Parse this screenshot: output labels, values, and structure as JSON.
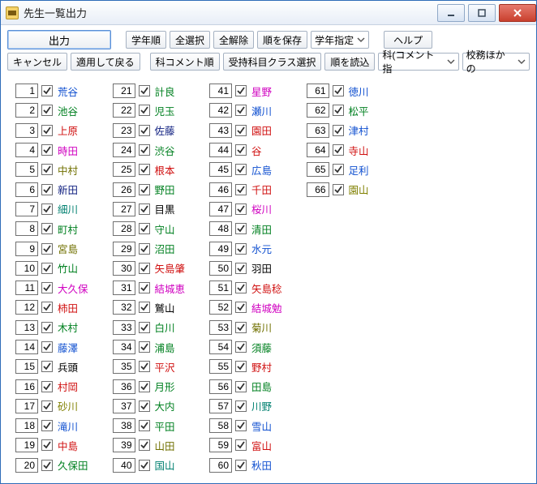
{
  "window": {
    "title": "先生一覧出力"
  },
  "toolbar": {
    "row1": {
      "primary": "出力",
      "b1": "学年順",
      "b2": "全選択",
      "b3": "全解除",
      "b4": "順を保存",
      "sel1": "学年指定",
      "help": "ヘルプ"
    },
    "row2": {
      "cancel": "キャンセル",
      "apply": "適用して戻る",
      "b1": "科コメント順",
      "b2": "受持科目クラス選択",
      "b3": "順を読込",
      "sel1": "科(コメント指",
      "sel2": "校務ほかの"
    }
  },
  "colors": {
    "blue": "#1050d0",
    "green": "#008020",
    "red": "#d01010",
    "magenta": "#d000c0",
    "darkolive": "#707000",
    "navy": "#102080",
    "teal": "#008070",
    "black": "#000000",
    "olive": "#808000"
  },
  "teachers": [
    {
      "n": 1,
      "name": "荒谷",
      "c": "blue"
    },
    {
      "n": 2,
      "name": "池谷",
      "c": "green"
    },
    {
      "n": 3,
      "name": "上原",
      "c": "red"
    },
    {
      "n": 4,
      "name": "時田",
      "c": "magenta"
    },
    {
      "n": 5,
      "name": "中村",
      "c": "darkolive"
    },
    {
      "n": 6,
      "name": "新田",
      "c": "navy"
    },
    {
      "n": 7,
      "name": "細川",
      "c": "teal"
    },
    {
      "n": 8,
      "name": "町村",
      "c": "green"
    },
    {
      "n": 9,
      "name": "宮島",
      "c": "darkolive"
    },
    {
      "n": 10,
      "name": "竹山",
      "c": "green"
    },
    {
      "n": 11,
      "name": "大久保",
      "c": "magenta"
    },
    {
      "n": 12,
      "name": "柿田",
      "c": "red"
    },
    {
      "n": 13,
      "name": "木村",
      "c": "green"
    },
    {
      "n": 14,
      "name": "藤澤",
      "c": "blue"
    },
    {
      "n": 15,
      "name": "兵頭",
      "c": "black"
    },
    {
      "n": 16,
      "name": "村岡",
      "c": "red"
    },
    {
      "n": 17,
      "name": "砂川",
      "c": "olive"
    },
    {
      "n": 18,
      "name": "滝川",
      "c": "blue"
    },
    {
      "n": 19,
      "name": "中島",
      "c": "red"
    },
    {
      "n": 20,
      "name": "久保田",
      "c": "green"
    },
    {
      "n": 21,
      "name": "計良",
      "c": "green"
    },
    {
      "n": 22,
      "name": "児玉",
      "c": "green"
    },
    {
      "n": 23,
      "name": "佐藤",
      "c": "navy"
    },
    {
      "n": 24,
      "name": "渋谷",
      "c": "green"
    },
    {
      "n": 25,
      "name": "根本",
      "c": "red"
    },
    {
      "n": 26,
      "name": "野田",
      "c": "green"
    },
    {
      "n": 27,
      "name": "目黒",
      "c": "black"
    },
    {
      "n": 28,
      "name": "守山",
      "c": "green"
    },
    {
      "n": 29,
      "name": "沼田",
      "c": "green"
    },
    {
      "n": 30,
      "name": "矢島肇",
      "c": "red"
    },
    {
      "n": 31,
      "name": "結城恵",
      "c": "magenta"
    },
    {
      "n": 32,
      "name": "鷲山",
      "c": "black"
    },
    {
      "n": 33,
      "name": "白川",
      "c": "green"
    },
    {
      "n": 34,
      "name": "浦島",
      "c": "green"
    },
    {
      "n": 35,
      "name": "平沢",
      "c": "red"
    },
    {
      "n": 36,
      "name": "月形",
      "c": "green"
    },
    {
      "n": 37,
      "name": "大内",
      "c": "green"
    },
    {
      "n": 38,
      "name": "平田",
      "c": "green"
    },
    {
      "n": 39,
      "name": "山田",
      "c": "darkolive"
    },
    {
      "n": 40,
      "name": "国山",
      "c": "teal"
    },
    {
      "n": 41,
      "name": "星野",
      "c": "magenta"
    },
    {
      "n": 42,
      "name": "瀬川",
      "c": "blue"
    },
    {
      "n": 43,
      "name": "園田",
      "c": "red"
    },
    {
      "n": 44,
      "name": "谷",
      "c": "red"
    },
    {
      "n": 45,
      "name": "広島",
      "c": "blue"
    },
    {
      "n": 46,
      "name": "千田",
      "c": "red"
    },
    {
      "n": 47,
      "name": "桜川",
      "c": "magenta"
    },
    {
      "n": 48,
      "name": "清田",
      "c": "green"
    },
    {
      "n": 49,
      "name": "水元",
      "c": "blue"
    },
    {
      "n": 50,
      "name": "羽田",
      "c": "black"
    },
    {
      "n": 51,
      "name": "矢島稔",
      "c": "red"
    },
    {
      "n": 52,
      "name": "結城勉",
      "c": "magenta"
    },
    {
      "n": 53,
      "name": "菊川",
      "c": "darkolive"
    },
    {
      "n": 54,
      "name": "須藤",
      "c": "green"
    },
    {
      "n": 55,
      "name": "野村",
      "c": "red"
    },
    {
      "n": 56,
      "name": "田島",
      "c": "green"
    },
    {
      "n": 57,
      "name": "川野",
      "c": "teal"
    },
    {
      "n": 58,
      "name": "雪山",
      "c": "blue"
    },
    {
      "n": 59,
      "name": "富山",
      "c": "red"
    },
    {
      "n": 60,
      "name": "秋田",
      "c": "blue"
    },
    {
      "n": 61,
      "name": "徳川",
      "c": "blue"
    },
    {
      "n": 62,
      "name": "松平",
      "c": "green"
    },
    {
      "n": 63,
      "name": "津村",
      "c": "blue"
    },
    {
      "n": 64,
      "name": "寺山",
      "c": "red"
    },
    {
      "n": 65,
      "name": "足利",
      "c": "blue"
    },
    {
      "n": 66,
      "name": "園山",
      "c": "olive"
    }
  ]
}
